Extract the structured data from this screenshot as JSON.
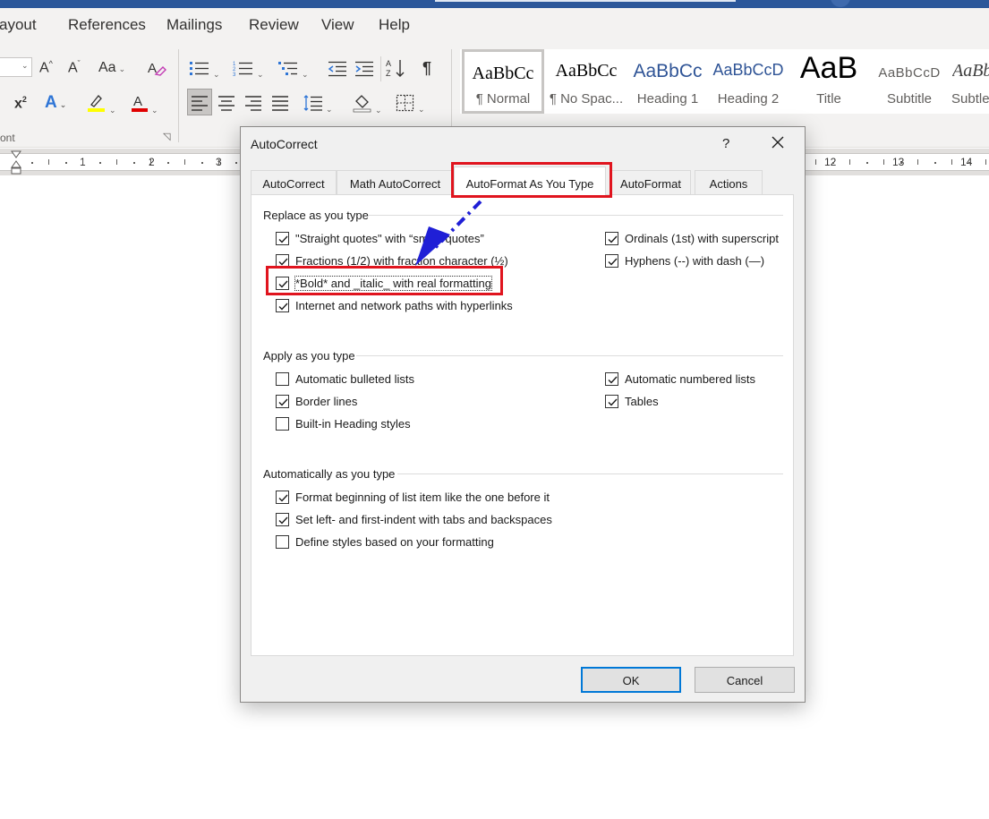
{
  "menu": {
    "items": [
      "Layout",
      "References",
      "Mailings",
      "Review",
      "View",
      "Help"
    ],
    "layout_visible": "ayout"
  },
  "ribbon": {
    "font_size_value": "",
    "font_group_label": "ont",
    "styles": [
      {
        "preview": "AaBbCc",
        "name": "¶ Normal",
        "selected": true
      },
      {
        "preview": "AaBbCc",
        "name": "¶ No Spac..."
      },
      {
        "preview": "AaBbCc",
        "name": "Heading 1"
      },
      {
        "preview": "AaBbCcD",
        "name": "Heading 2"
      },
      {
        "preview": "AaB",
        "name": "Title"
      },
      {
        "preview": "AaBbCcD",
        "name": "Subtitle"
      },
      {
        "preview": "AaBb",
        "name": "Subtle"
      }
    ],
    "colors": {
      "highlight": "#ffff00",
      "font_color": "#e00000",
      "text_effect": "#2e75d6"
    }
  },
  "ruler": {
    "numbers": [
      "1",
      "2",
      "3",
      "12",
      "13",
      "14"
    ]
  },
  "dialog": {
    "title": "AutoCorrect",
    "help": "?",
    "tabs": [
      {
        "label": "AutoCorrect"
      },
      {
        "label": "Math AutoCorrect"
      },
      {
        "label": "AutoFormat As You Type",
        "active": true
      },
      {
        "label": "AutoFormat"
      },
      {
        "label": "Actions"
      }
    ],
    "sections": {
      "replace": "Replace as you type",
      "apply": "Apply as you type",
      "auto": "Automatically as you type"
    },
    "replace_left": [
      {
        "label": "\"Straight quotes\" with “smart quotes”",
        "checked": true
      },
      {
        "label": "Fractions (1/2) with fraction character (½)",
        "checked": true
      },
      {
        "label": "*Bold* and _italic_ with real formatting",
        "checked": true
      },
      {
        "label": "Internet and network paths with hyperlinks",
        "checked": true
      }
    ],
    "replace_right": [
      {
        "label": "Ordinals (1st) with superscript",
        "checked": true
      },
      {
        "label": "Hyphens (--) with dash (—)",
        "checked": true
      }
    ],
    "apply_left": [
      {
        "label": "Automatic bulleted lists",
        "checked": false
      },
      {
        "label": "Border lines",
        "checked": true
      },
      {
        "label": "Built-in Heading styles",
        "checked": false
      }
    ],
    "apply_right": [
      {
        "label": "Automatic numbered lists",
        "checked": true
      },
      {
        "label": "Tables",
        "checked": true
      }
    ],
    "auto_items": [
      {
        "label": "Format beginning of list item like the one before it",
        "checked": true
      },
      {
        "label": "Set left- and first-indent with tabs and backspaces",
        "checked": true
      },
      {
        "label": "Define styles based on your formatting",
        "checked": false
      }
    ],
    "ok_label": "OK",
    "cancel_label": "Cancel"
  },
  "annotation": {
    "highlight_color": "#e0141e",
    "arrow_color": "#1f1fd6"
  }
}
